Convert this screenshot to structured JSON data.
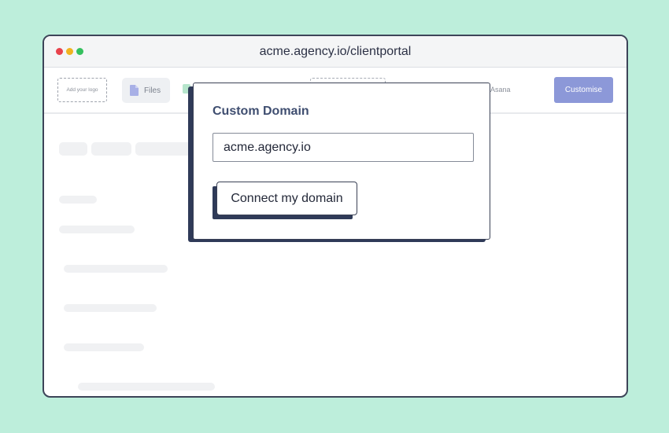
{
  "browser": {
    "url": "acme.agency.io/clientportal",
    "controls": [
      "close",
      "minimize",
      "maximize"
    ]
  },
  "toolbar": {
    "logo_placeholder": "Add your logo",
    "files_tab": "Files",
    "asana_tab": "Asana",
    "customise_label": "Customise"
  },
  "modal": {
    "title": "Custom Domain",
    "domain_value": "acme.agency.io",
    "connect_label": "Connect my domain"
  },
  "icons": {
    "files": "file-icon"
  },
  "colors": {
    "background": "#bdeedb",
    "accent": "#8c98d8",
    "navy": "#2f3a58"
  }
}
